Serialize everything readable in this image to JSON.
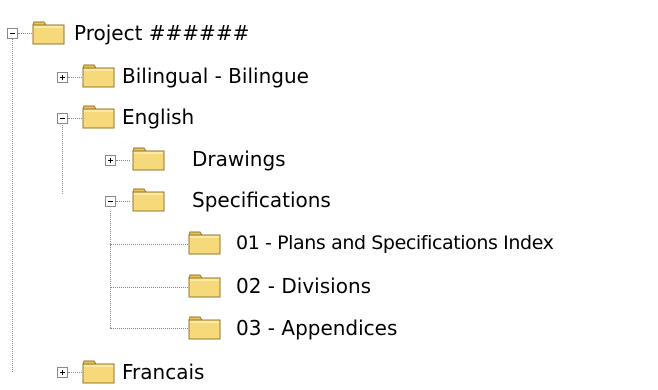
{
  "tree": {
    "root": {
      "label": "Project ######",
      "state": "expanded"
    },
    "nodes": [
      {
        "id": "bilingual",
        "label": "Bilingual - Bilingue",
        "state": "collapsed"
      },
      {
        "id": "english",
        "label": "English",
        "state": "expanded"
      },
      {
        "id": "drawings",
        "label": "Drawings",
        "state": "collapsed"
      },
      {
        "id": "specifications",
        "label": "Specifications",
        "state": "expanded"
      },
      {
        "id": "spec01",
        "label": "01 - Plans and Specifications Index"
      },
      {
        "id": "spec02",
        "label": "02 - Divisions"
      },
      {
        "id": "spec03",
        "label": "03 - Appendices"
      },
      {
        "id": "francais",
        "label": "Francais",
        "state": "collapsed"
      }
    ]
  },
  "icons": {
    "folder": "folder-icon",
    "expanded_box": "minus-box",
    "collapsed_box": "plus-box"
  },
  "colors": {
    "folder_front": "#f6d97a",
    "folder_back": "#e9c25a",
    "folder_outline": "#9a7a2a",
    "tree_lines": "#8a8a8a"
  }
}
